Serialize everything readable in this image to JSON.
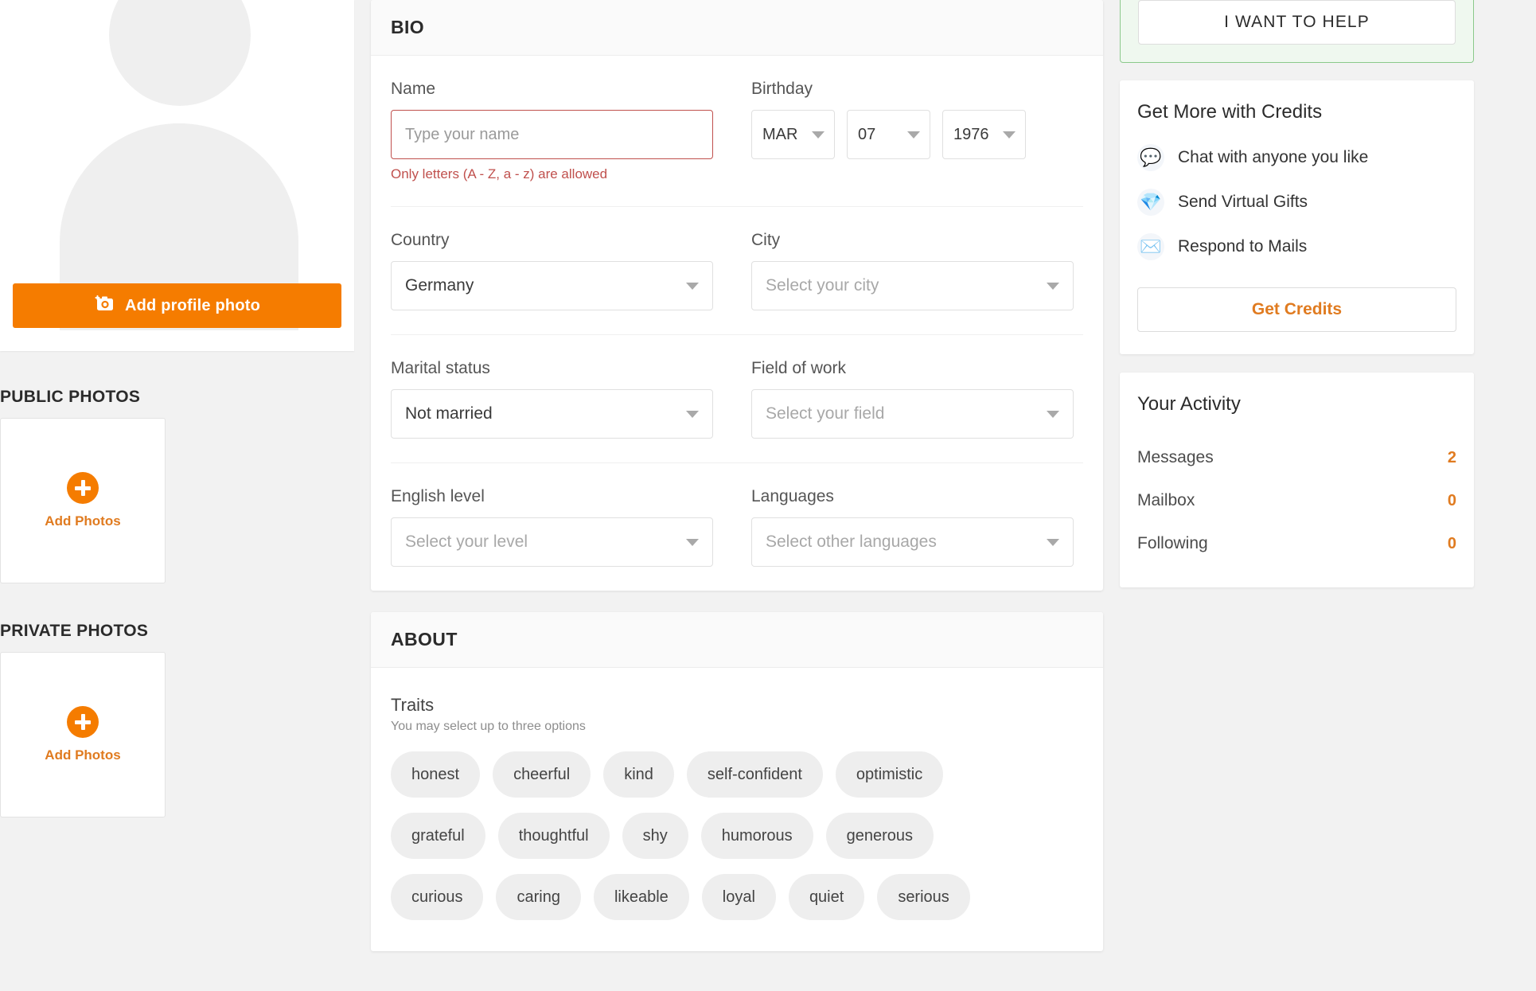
{
  "left": {
    "avatar_placeholder": "avatar-placeholder",
    "add_profile_photo_label": "Add profile photo",
    "public_photos": {
      "title": "PUBLIC PHOTOS",
      "add_label": "Add Photos"
    },
    "private_photos": {
      "title": "PRIVATE PHOTOS",
      "add_label": "Add Photos"
    }
  },
  "bio": {
    "header": "BIO",
    "name": {
      "label": "Name",
      "value": "",
      "placeholder": "Type your name",
      "error": "Only letters (A - Z, a - z) are allowed"
    },
    "birthday": {
      "label": "Birthday",
      "month": "MAR",
      "day": "07",
      "year": "1976"
    },
    "country": {
      "label": "Country",
      "value": "Germany"
    },
    "city": {
      "label": "City",
      "value": "Select your city",
      "is_placeholder": true
    },
    "marital_status": {
      "label": "Marital status",
      "value": "Not married"
    },
    "field_of_work": {
      "label": "Field of work",
      "value": "Select your field",
      "is_placeholder": true
    },
    "english_level": {
      "label": "English level",
      "value": "Select your level",
      "is_placeholder": true
    },
    "languages": {
      "label": "Languages",
      "value": "Select other languages",
      "is_placeholder": true
    }
  },
  "about": {
    "header": "ABOUT",
    "traits": {
      "title": "Traits",
      "subtitle": "You may select up to three options",
      "rows": [
        [
          "honest",
          "cheerful",
          "kind",
          "self-confident",
          "optimistic"
        ],
        [
          "grateful",
          "thoughtful",
          "shy",
          "humorous",
          "generous"
        ],
        [
          "curious",
          "caring",
          "likeable",
          "loyal",
          "quiet",
          "serious"
        ]
      ]
    }
  },
  "right": {
    "help_card": {
      "button_label": "I WANT TO HELP"
    },
    "credits": {
      "title": "Get More with Credits",
      "items": [
        {
          "icon": "speech-balloon-icon",
          "glyph": "💬",
          "label": "Chat with anyone you like"
        },
        {
          "icon": "gem-icon",
          "glyph": "💎",
          "label": "Send Virtual Gifts"
        },
        {
          "icon": "envelope-icon",
          "glyph": "✉️",
          "label": "Respond to Mails"
        }
      ],
      "button_label": "Get Credits"
    },
    "activity": {
      "title": "Your Activity",
      "rows": [
        {
          "label": "Messages",
          "count": "2"
        },
        {
          "label": "Mailbox",
          "count": "0"
        },
        {
          "label": "Following",
          "count": "0"
        }
      ]
    }
  },
  "colors": {
    "accent_orange": "#f57c00",
    "error_red": "#c0504d",
    "help_green_bg": "#eff8ef",
    "help_green_border": "#8bc98b"
  }
}
